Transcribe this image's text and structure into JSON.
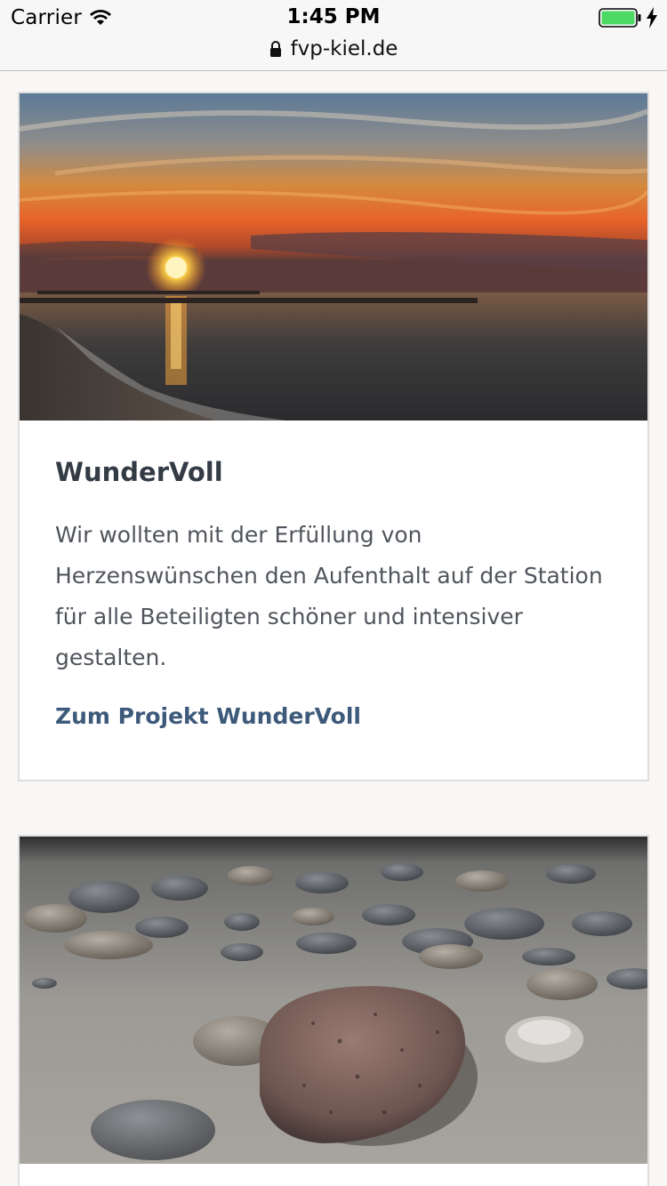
{
  "status_bar": {
    "carrier": "Carrier",
    "time": "1:45 PM",
    "battery_color": "#4cd964"
  },
  "browser": {
    "url": "fvp-kiel.de"
  },
  "cards": [
    {
      "image": "sunset-beach-photo",
      "title": "WunderVoll",
      "text": "Wir wollten mit der Erfüllung von Herzenswünschen den Aufenthalt auf der Station für alle Beteiligten schöner und intensiver gestalten.",
      "link_label": "Zum Projekt WunderVoll",
      "link_color": "#3d5a7a"
    },
    {
      "image": "beach-pebbles-photo"
    }
  ]
}
